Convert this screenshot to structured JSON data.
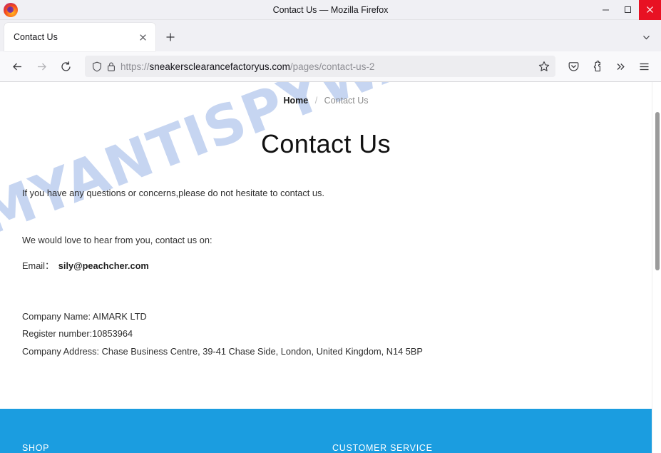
{
  "window": {
    "title": "Contact Us — Mozilla Firefox",
    "logo_icon": "firefox-logo",
    "minimize_label": "Minimize",
    "maximize_label": "Maximize",
    "close_label": "Close"
  },
  "tabs": {
    "items": [
      {
        "label": "Contact Us",
        "close_label": "Close tab"
      }
    ],
    "new_tab_label": "New tab",
    "list_all_tabs_label": "List all tabs"
  },
  "toolbar": {
    "back_label": "Back",
    "forward_label": "Forward",
    "reload_label": "Reload",
    "tracking_protection_label": "Tracking protection",
    "site_security_label": "Connection secure",
    "bookmark_label": "Bookmark this page",
    "pocket_label": "Save to Pocket",
    "extensions_label": "Extensions",
    "overflow_label": "More tools",
    "menu_label": "Open application menu"
  },
  "url": {
    "scheme": "https://",
    "host": "sneakersclearancefactoryus.com",
    "path": "/pages/contact-us-2"
  },
  "breadcrumb": {
    "home": "Home",
    "separator": "/",
    "current": "Contact Us"
  },
  "page": {
    "title": "Contact Us",
    "intro": "If you have any questions or concerns,please do not hesitate to contact us.",
    "invite": "We would love to hear from you, contact us on:",
    "email_label": "Email：",
    "email_value": "sily@peachcher.com",
    "company_name": "Company Name: AIMARK LTD",
    "register_number": "Register number:10853964",
    "company_address": "Company Address: Chase Business Centre, 39-41 Chase Side, London, United Kingdom, N14 5BP"
  },
  "watermark": {
    "text": "MYANTISPYWARE.COM",
    "color": "#c6d5f1"
  },
  "footer": {
    "background_color": "#1b9de0",
    "columns": [
      {
        "heading": "SHOP"
      },
      {
        "heading": "CUSTOMER SERVICE"
      }
    ]
  }
}
